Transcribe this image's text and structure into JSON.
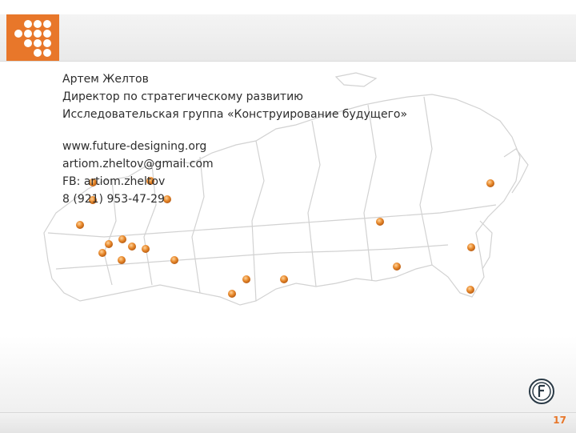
{
  "slide": {
    "name_line": "Артем Желтов",
    "position_line": "Директор по стратегическому развитию",
    "organization_line": "Исследовательская группа «Конструирование будущего»",
    "website": "www.future-designing.org",
    "email": "artiom.zheltov@gmail.com",
    "facebook": "FB: artiom.zheltov",
    "phone": "8 (921) 953-47-29",
    "page_number": "17"
  },
  "colors": {
    "accent": "#e8772a",
    "map_dot": "#e08a2e",
    "map_outline": "#cfcfcf",
    "text": "#2d2d2d"
  },
  "icons": [
    "brand-logo-icon",
    "future-f-icon"
  ]
}
